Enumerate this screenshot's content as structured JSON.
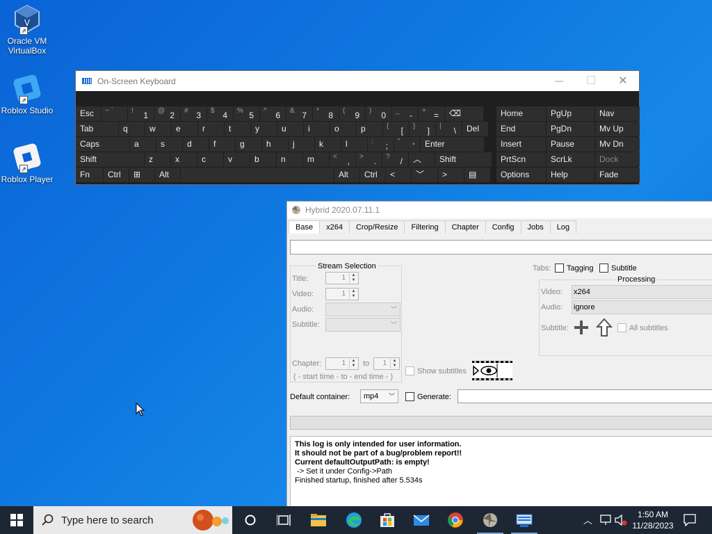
{
  "desktop": {
    "icons": [
      {
        "label_line1": "Oracle VM",
        "label_line2": "VirtualBox"
      },
      {
        "label_line1": "Roblox Studio"
      },
      {
        "label_line1": "Roblox Player"
      }
    ]
  },
  "osk": {
    "title": "On-Screen Keyboard",
    "controls": {
      "minimize": "—",
      "maximize": "☐",
      "close": "✕"
    },
    "rows": [
      [
        {
          "label": "Esc"
        },
        {
          "sup": "~ `",
          "label": ""
        },
        {
          "sup": "!",
          "label": "1"
        },
        {
          "sup": "@",
          "label": "2"
        },
        {
          "sup": "#",
          "label": "3"
        },
        {
          "sup": "$",
          "label": "4"
        },
        {
          "sup": "%",
          "label": "5"
        },
        {
          "sup": "^",
          "label": "6"
        },
        {
          "sup": "&",
          "label": "7"
        },
        {
          "sup": "*",
          "label": "8"
        },
        {
          "sup": "(",
          "label": "9"
        },
        {
          "sup": ")",
          "label": "0"
        },
        {
          "sup": "_",
          "label": "-"
        },
        {
          "sup": "+",
          "label": "="
        },
        {
          "label": "⌫"
        }
      ],
      [
        {
          "label": "Tab"
        },
        {
          "label": "q"
        },
        {
          "label": "w"
        },
        {
          "label": "e"
        },
        {
          "label": "r"
        },
        {
          "label": "t"
        },
        {
          "label": "y"
        },
        {
          "label": "u"
        },
        {
          "label": "i"
        },
        {
          "label": "o"
        },
        {
          "label": "p"
        },
        {
          "sup": "{",
          "label": "["
        },
        {
          "sup": "}",
          "label": "]"
        },
        {
          "sup": "|",
          "label": "\\"
        },
        {
          "label": "Del"
        }
      ],
      [
        {
          "label": "Caps"
        },
        {
          "label": "a"
        },
        {
          "label": "s"
        },
        {
          "label": "d"
        },
        {
          "label": "f"
        },
        {
          "label": "g"
        },
        {
          "label": "h"
        },
        {
          "label": "j"
        },
        {
          "label": "k"
        },
        {
          "label": "l"
        },
        {
          "sup": ":",
          "label": ";"
        },
        {
          "sup": "\"",
          "label": "'"
        },
        {
          "label": "Enter"
        }
      ],
      [
        {
          "label": "Shift"
        },
        {
          "label": "z"
        },
        {
          "label": "x"
        },
        {
          "label": "c"
        },
        {
          "label": "v"
        },
        {
          "label": "b"
        },
        {
          "label": "n"
        },
        {
          "label": "m"
        },
        {
          "sup": "<",
          "label": ","
        },
        {
          "sup": ">",
          "label": "."
        },
        {
          "sup": "?",
          "label": "/"
        },
        {
          "label": "︿"
        },
        {
          "label": "Shift"
        }
      ],
      [
        {
          "label": "Fn"
        },
        {
          "label": "Ctrl"
        },
        {
          "label": "⊞"
        },
        {
          "label": "Alt"
        },
        {
          "label": ""
        },
        {
          "label": "Alt"
        },
        {
          "label": "Ctrl"
        },
        {
          "label": "<"
        },
        {
          "label": "﹀"
        },
        {
          "label": ">"
        },
        {
          "label": "▤"
        }
      ]
    ],
    "nav": [
      [
        {
          "label": "Home"
        },
        {
          "label": "PgUp"
        },
        {
          "label": "Nav"
        }
      ],
      [
        {
          "label": "End"
        },
        {
          "label": "PgDn"
        },
        {
          "label": "Mv Up"
        }
      ],
      [
        {
          "label": "Insert"
        },
        {
          "label": "Pause"
        },
        {
          "label": "Mv Dn"
        }
      ],
      [
        {
          "label": "PrtScn"
        },
        {
          "label": "ScrLk"
        },
        {
          "label": "Dock"
        }
      ],
      [
        {
          "label": "Options"
        },
        {
          "label": "Help"
        },
        {
          "label": "Fade"
        }
      ]
    ]
  },
  "hybrid": {
    "title": "Hybrid 2020.07.11.1",
    "tabs": [
      "Base",
      "x264",
      "Crop/Resize",
      "Filtering",
      "Chapter",
      "Config",
      "Jobs",
      "Log"
    ],
    "active_tab": "Base",
    "stream_selection": {
      "label": "Stream Selection",
      "title_label": "Title:",
      "title_value": "1",
      "video_label": "Video:",
      "video_value": "1",
      "audio_label": "Audio:",
      "subtitle_label": "Subtitle:",
      "chapter_label": "Chapter:",
      "chapter_from": "1",
      "to_label": "to",
      "chapter_to": "1",
      "time_hint": "( - start time -  to  - end time - )"
    },
    "tabs_row": {
      "label": "Tabs:",
      "tagging": "Tagging",
      "subtitle": "Subtitle"
    },
    "processing": {
      "label": "Processing",
      "video_label": "Video:",
      "video_value": "x264",
      "audio_label": "Audio:",
      "audio_value": "ignore",
      "subtitle_label": "Subtitle:",
      "all_subtitles": "All subtitles"
    },
    "show_subtitles": "Show subtitles",
    "default_container_label": "Default container:",
    "default_container_value": "mp4",
    "generate_label": "Generate:",
    "log": {
      "bold_lines": [
        "This log is only intended for user information.",
        "It should not be part of a bug/problem report!!",
        "Current defaultOutputPath: is empty!"
      ],
      "normal_lines": [
        " -> Set it under Config->Path",
        "Finished startup, finished after 5.534s"
      ]
    }
  },
  "taskbar": {
    "search_placeholder": "Type here to search",
    "time": "1:50 AM",
    "date": "11/28/2023"
  }
}
